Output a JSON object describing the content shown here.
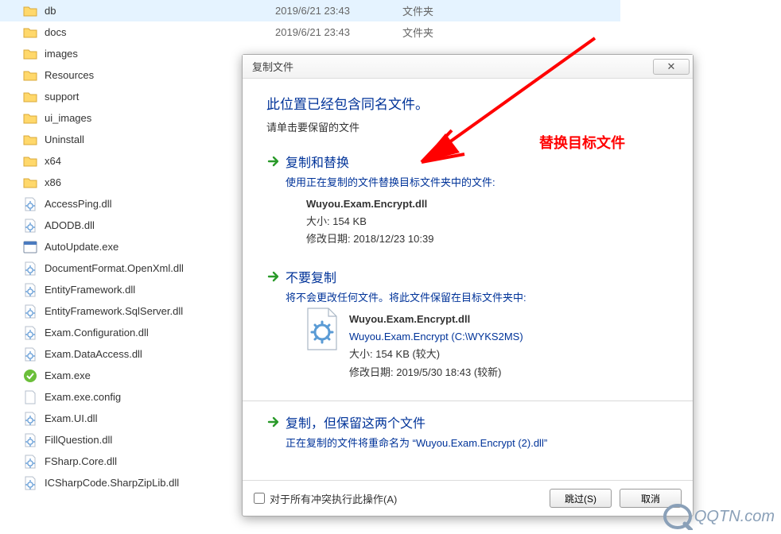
{
  "explorer": {
    "rows": [
      {
        "name": "db",
        "date": "2019/6/21 23:43",
        "type": "文件夹",
        "kind": "folder",
        "selected": true
      },
      {
        "name": "docs",
        "date": "2019/6/21 23:43",
        "type": "文件夹",
        "kind": "folder"
      },
      {
        "name": "images",
        "date": "",
        "type": "",
        "kind": "folder"
      },
      {
        "name": "Resources",
        "date": "",
        "type": "",
        "kind": "folder"
      },
      {
        "name": "support",
        "date": "",
        "type": "",
        "kind": "folder"
      },
      {
        "name": "ui_images",
        "date": "",
        "type": "",
        "kind": "folder"
      },
      {
        "name": "Uninstall",
        "date": "",
        "type": "",
        "kind": "folder"
      },
      {
        "name": "x64",
        "date": "",
        "type": "",
        "kind": "folder"
      },
      {
        "name": "x86",
        "date": "",
        "type": "",
        "kind": "folder"
      },
      {
        "name": "AccessPing.dll",
        "kind": "dll"
      },
      {
        "name": "ADODB.dll",
        "kind": "dll"
      },
      {
        "name": "AutoUpdate.exe",
        "kind": "exe"
      },
      {
        "name": "DocumentFormat.OpenXml.dll",
        "kind": "dll"
      },
      {
        "name": "EntityFramework.dll",
        "kind": "dll"
      },
      {
        "name": "EntityFramework.SqlServer.dll",
        "kind": "dll"
      },
      {
        "name": "Exam.Configuration.dll",
        "kind": "dll"
      },
      {
        "name": "Exam.DataAccess.dll",
        "kind": "dll"
      },
      {
        "name": "Exam.exe",
        "kind": "exe-green"
      },
      {
        "name": "Exam.exe.config",
        "kind": "file"
      },
      {
        "name": "Exam.UI.dll",
        "kind": "dll"
      },
      {
        "name": "FillQuestion.dll",
        "kind": "dll"
      },
      {
        "name": "FSharp.Core.dll",
        "kind": "dll"
      },
      {
        "name": "ICSharpCode.SharpZipLib.dll",
        "kind": "dll"
      }
    ]
  },
  "dialog": {
    "title": "复制文件",
    "close_glyph": "✕",
    "headline": "此位置已经包含同名文件。",
    "subhead": "请单击要保留的文件",
    "option1": {
      "title": "复制和替换",
      "desc": "使用正在复制的文件替换目标文件夹中的文件:",
      "file": "Wuyou.Exam.Encrypt.dll",
      "size": "大小: 154 KB",
      "modified": "修改日期: 2018/12/23 10:39"
    },
    "option2": {
      "title": "不要复制",
      "desc": "将不会更改任何文件。将此文件保留在目标文件夹中:",
      "file": "Wuyou.Exam.Encrypt.dll",
      "location": "Wuyou.Exam.Encrypt (C:\\WYKS2MS)",
      "size": "大小: 154 KB (较大)",
      "modified": "修改日期: 2019/5/30 18:43 (较新)"
    },
    "option3": {
      "title": "复制，但保留这两个文件",
      "desc_prefix": "正在复制的文件将重命名为",
      "desc_quoted": "“Wuyou.Exam.Encrypt (2).dll”"
    },
    "footer": {
      "checkbox_label": "对于所有冲突执行此操作(A)",
      "skip": "跳过(S)",
      "cancel": "取消"
    }
  },
  "annotation": {
    "text": "替换目标文件"
  },
  "watermark": {
    "text": "QQTN.com"
  }
}
